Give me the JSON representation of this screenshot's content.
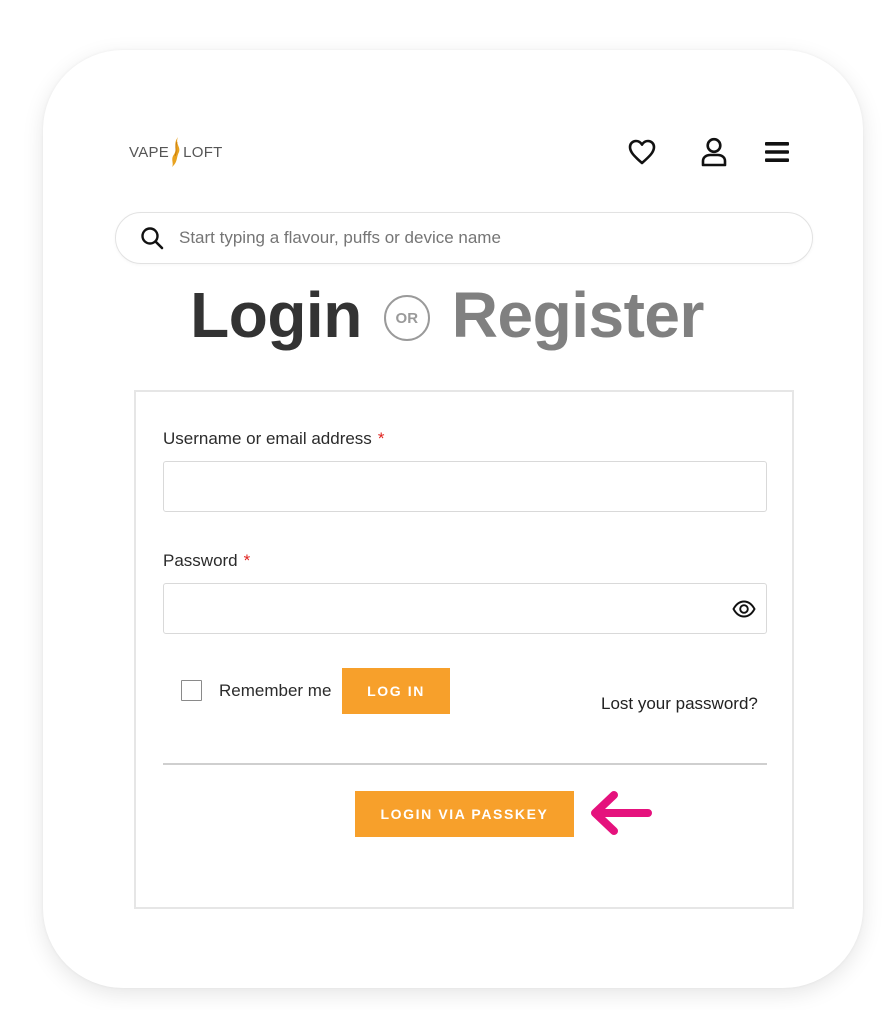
{
  "brand": {
    "logo_left": "VAPE",
    "logo_right": "LOFT",
    "accent": "#f7a02b"
  },
  "header": {
    "icons": [
      "heart-icon",
      "user-icon",
      "menu-icon"
    ]
  },
  "search": {
    "placeholder": "Start typing a flavour, puffs or device name",
    "value": ""
  },
  "title": {
    "login": "Login",
    "or": "OR",
    "register": "Register"
  },
  "form": {
    "username_label": "Username or email address",
    "password_label": "Password",
    "required_mark": "*",
    "username_value": "",
    "password_value": "",
    "remember_label": "Remember me",
    "remember_checked": false,
    "login_button": "LOG IN",
    "lost_password": "Lost your password?",
    "passkey_button": "LOGIN VIA PASSKEY"
  },
  "colors": {
    "button": "#f7a02b",
    "annotation_arrow": "#e5127d",
    "required": "#e0231f"
  }
}
